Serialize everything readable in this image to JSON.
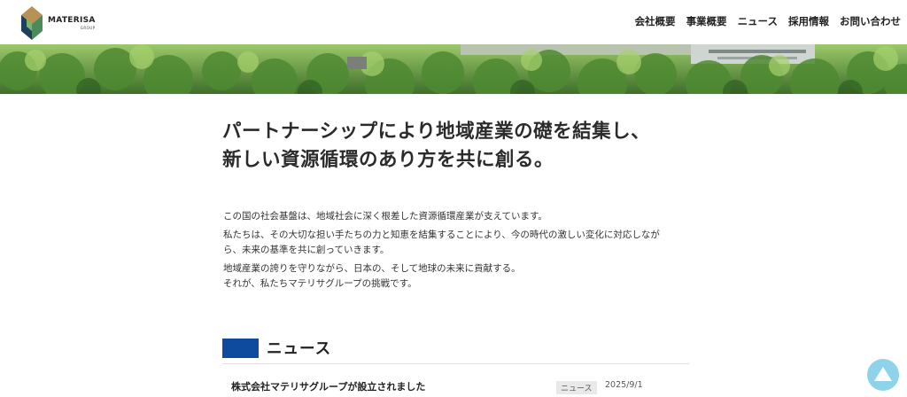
{
  "header": {
    "logo_name": "MATERISA",
    "logo_group": "GROUP",
    "nav": [
      {
        "label": "会社概要"
      },
      {
        "label": "事業概要"
      },
      {
        "label": "ニュース"
      },
      {
        "label": "採用情報"
      },
      {
        "label": "お問い合わせ"
      }
    ]
  },
  "main": {
    "headline_line1": "パートナーシップにより地域産業の礎を結集し、",
    "headline_line2": "新しい資源循環のあり方を共に創る。",
    "paragraphs": [
      {
        "line1": "この国の社会基盤は、地域社会に深く根差した資源循環産業が支えています。"
      },
      {
        "line1": "私たちは、その大切な担い手たちの力と知恵を結集することにより、今の時代の激しい変化に対応しなが",
        "line2": "ら、未来の基準を共に創っていきます。"
      },
      {
        "line1": "地域産業の誇りを守りながら、日本の、そして地球の未来に貢献する。",
        "line2": "それが、私たちマテリサグループの挑戦です。"
      }
    ]
  },
  "news": {
    "heading": "ニュース",
    "items": [
      {
        "title": "株式会社マテリサグループが設立されました",
        "category": "ニュース",
        "date": "2025/9/1"
      }
    ]
  },
  "colors": {
    "accent": "#0e4a9e",
    "scroll_top": "#8fd3ea"
  },
  "icons": {
    "logo": "materisa-logo-icon",
    "scroll_top": "arrow-up-icon"
  }
}
